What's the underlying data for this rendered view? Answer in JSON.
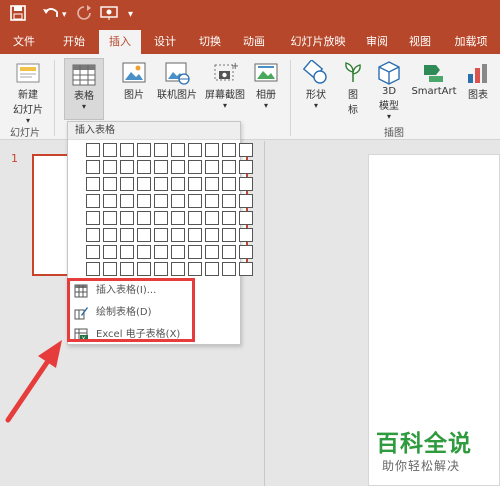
{
  "quick_access": {
    "save_icon": "save-icon",
    "undo_icon": "undo-icon",
    "redo_icon": "redo-icon",
    "present_icon": "present-from-start-icon",
    "customize_icon": "customize-quick-access-icon"
  },
  "tabs": [
    {
      "label": "文件"
    },
    {
      "label": "开始"
    },
    {
      "label": "插入"
    },
    {
      "label": "设计"
    },
    {
      "label": "切换"
    },
    {
      "label": "动画"
    },
    {
      "label": "幻灯片放映"
    },
    {
      "label": "审阅"
    },
    {
      "label": "视图"
    },
    {
      "label": "加载项"
    }
  ],
  "active_tab": "插入",
  "ribbon": {
    "new_slide": {
      "line1": "新建",
      "line2": "幻灯片"
    },
    "group_slides": "幻灯片",
    "table": "表格",
    "picture": "图片",
    "online_picture": "联机图片",
    "screenshot": "屏幕截图",
    "album": "相册",
    "shapes": "形状",
    "icons": {
      "line1": "图",
      "line2": "标"
    },
    "model3d": {
      "line1": "3D",
      "line2": "模型"
    },
    "smartart": "SmartArt",
    "chart": "图表",
    "group_illustrations": "插图"
  },
  "slide_panel": {
    "number": "1"
  },
  "dropdown": {
    "title": "插入表格",
    "grid": {
      "cols": 10,
      "rows": 8
    },
    "items": [
      {
        "label": "插入表格(I)...",
        "icon": "insert-table-icon"
      },
      {
        "label": "绘制表格(D)",
        "icon": "draw-table-icon"
      },
      {
        "label": "Excel 电子表格(X)",
        "icon": "excel-spreadsheet-icon"
      }
    ]
  },
  "watermark": {
    "line1": "百科全说",
    "line2": "助你轻松解决"
  },
  "colors": {
    "accent": "#b7472a",
    "highlight": "#e63c3c",
    "watermark_green": "#2e9b3e"
  }
}
